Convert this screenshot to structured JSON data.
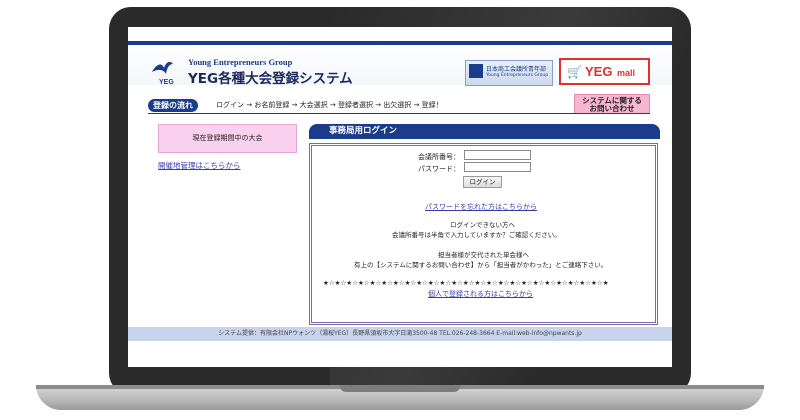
{
  "header": {
    "org_name": "Young Entrepreneurs Group",
    "logo_text": "YEG",
    "title": "YEG各種大会登録システム",
    "banner1_line1": "日本商工会議所青年部",
    "banner1_line2": "Young Entrepreneurs Group",
    "banner2_yeg": "YEG",
    "banner2_mall": "mall"
  },
  "flow": {
    "label": "登録の流れ",
    "steps": "ログイン → お名前登録 → 大会選択 → 登録者選択 → 出欠選択 → 登録！"
  },
  "contact_button": {
    "line1": "システムに関する",
    "line2": "お問い合わせ"
  },
  "sidebar": {
    "current_events": "現在登録期間中の大会",
    "host_admin_link": "開催地管理はこちらから"
  },
  "login": {
    "heading": "事務局用ログイン",
    "chamber_no_label": "会議所番号：",
    "password_label": "パスワード：",
    "chamber_no_value": "",
    "password_value": "",
    "submit_label": "ログイン",
    "forgot_link": "パスワードを忘れた方はこちらから",
    "help_line1": "ログインできない方へ",
    "help_line2": "会議所番号は半角で入力していますか？ご確認ください。",
    "note_line1": "担当者様が交代された単会様へ",
    "note_line2": "有上の【システムに関するお問い合わせ】から「担当者がかわった」とご連絡下さい。",
    "stars": "★☆★☆★☆★☆★☆★☆★☆★☆★☆★☆★☆★☆★☆★☆★☆★☆★☆★☆★☆★☆★☆★☆★☆★☆★",
    "individual_link": "個人で登録される方はこちらから"
  },
  "footer": {
    "text": "システム提供：有限会社NPウォンツ（湯桜YEG）長野県須坂市大字日滝3500-48 TEL.026-248-3664 E-mail:web-info@npwants.jp"
  },
  "colors": {
    "brand_navy": "#1a3c8a",
    "pink_box": "#f9d0ee",
    "contact_pink": "#f7b7d0",
    "mall_red": "#e03030",
    "footer_blue": "#c9d3ee"
  }
}
